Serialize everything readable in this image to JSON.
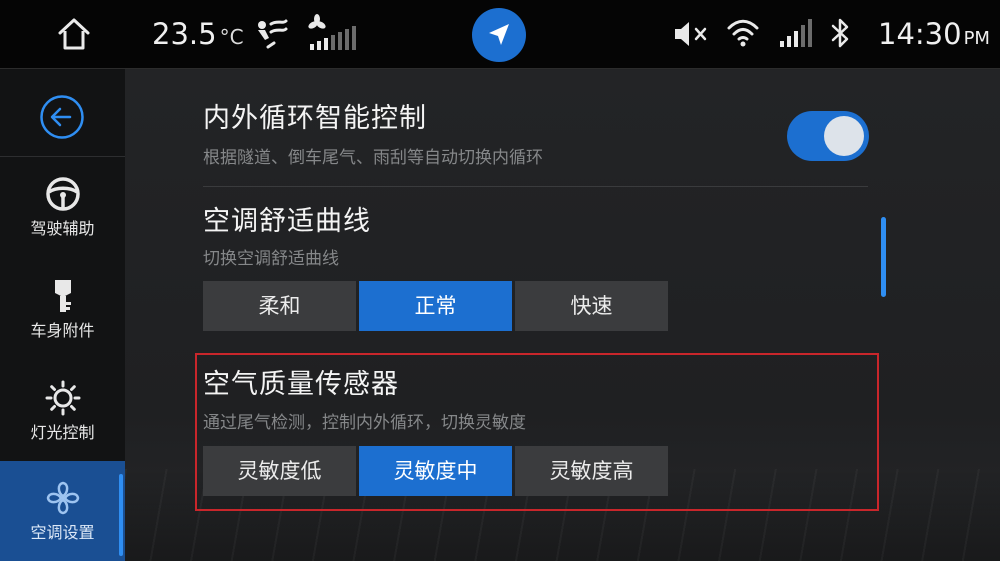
{
  "status_bar": {
    "temperature": "23.5",
    "temperature_unit": "°C",
    "time": "14:30",
    "time_suffix": "PM",
    "icons": [
      "home-icon",
      "airflow-icon",
      "fan-speed-icon",
      "navigation-icon",
      "mute-icon",
      "wifi-icon",
      "signal-icon",
      "bluetooth-icon"
    ],
    "fan_level": 1,
    "fan_levels_total": 7
  },
  "sidebar": {
    "back_icon": "back-arrow-icon",
    "items": [
      {
        "label": "驾驶辅助",
        "icon": "steering-wheel-icon",
        "active": false
      },
      {
        "label": "车身附件",
        "icon": "car-key-icon",
        "active": false
      },
      {
        "label": "灯光控制",
        "icon": "light-icon",
        "active": false
      },
      {
        "label": "空调设置",
        "icon": "ac-fan-icon",
        "active": true
      }
    ]
  },
  "settings": {
    "recirc": {
      "title": "内外循环智能控制",
      "subtitle": "根据隧道、倒车尾气、雨刮等自动切换内循环",
      "enabled": true
    },
    "comfort_curve": {
      "title": "空调舒适曲线",
      "subtitle": "切换空调舒适曲线",
      "options": [
        "柔和",
        "正常",
        "快速"
      ],
      "selected": "正常"
    },
    "air_quality": {
      "title": "空气质量传感器",
      "subtitle": "通过尾气检测，控制内外循环，切换灵敏度",
      "options": [
        "灵敏度低",
        "灵敏度中",
        "灵敏度高"
      ],
      "selected": "灵敏度中"
    }
  },
  "colors": {
    "accent": "#1c6fd0",
    "highlight_border": "#c9262b",
    "background": "#202123"
  }
}
